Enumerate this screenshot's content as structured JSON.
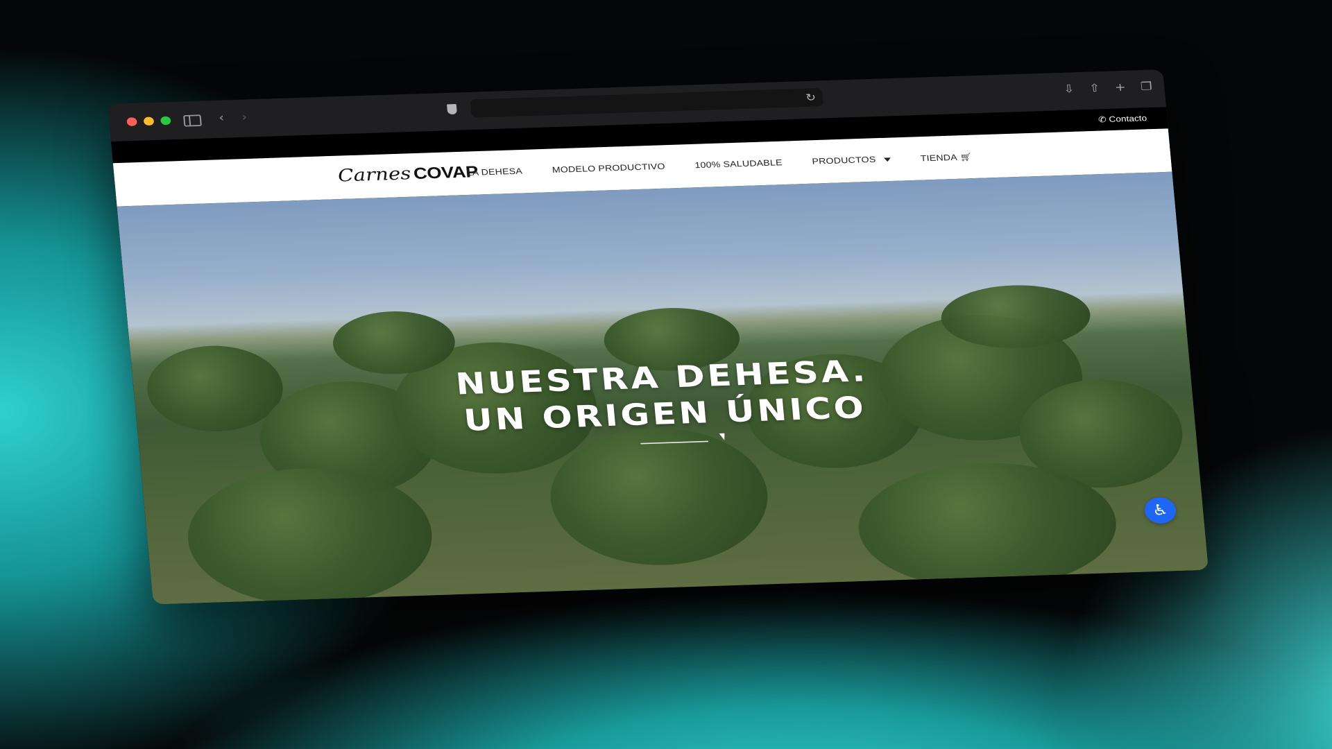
{
  "browser": {
    "url": "",
    "icons": {
      "sidebar": "sidebar-icon",
      "back": "chevron-left-icon",
      "forward": "chevron-right-icon",
      "shield": "shield-icon",
      "reload": "reload-icon",
      "download": "download-icon",
      "share": "share-icon",
      "new_tab": "plus-icon",
      "tabs": "tabs-overview-icon"
    }
  },
  "topbar": {
    "contact_label": "Contacto",
    "contact_icon": "phone-icon"
  },
  "nav": {
    "logo_script": "Carnes",
    "logo_brand": "COVAP",
    "items": [
      {
        "label": "LA DEHESA"
      },
      {
        "label": "MODELO PRODUCTIVO"
      },
      {
        "label": "100% SALUDABLE"
      },
      {
        "label": "PRODUCTOS"
      },
      {
        "label": "TIENDA"
      }
    ]
  },
  "hero": {
    "title_line1": "NUESTRA DEHESA.",
    "title_line2": "UN ORIGEN ÚNICO"
  },
  "colors": {
    "accessibility_button": "#1e66f5",
    "nav_background": "#ffffff",
    "topbar_background": "#000000"
  }
}
